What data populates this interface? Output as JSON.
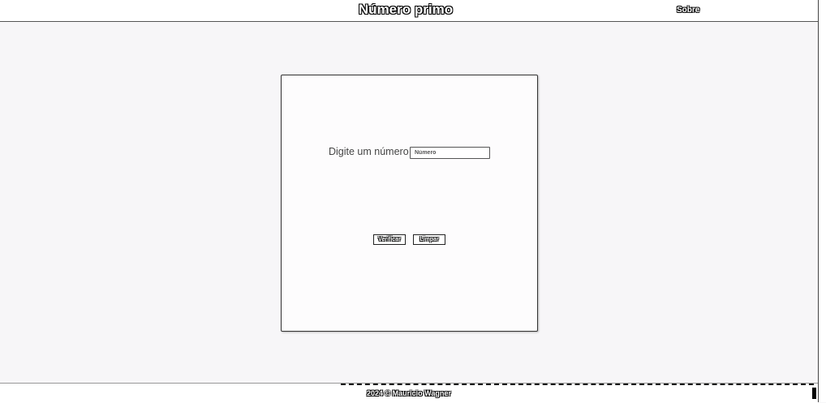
{
  "header": {
    "title": "Número primo",
    "about_label": "Sobre"
  },
  "form": {
    "label": "Digite um número",
    "input_placeholder": "Número",
    "input_value": ""
  },
  "buttons": {
    "verify_label": "Verificar",
    "clear_label": "Limpar"
  },
  "footer": {
    "text": "2024 © Mauricio Wagner"
  }
}
